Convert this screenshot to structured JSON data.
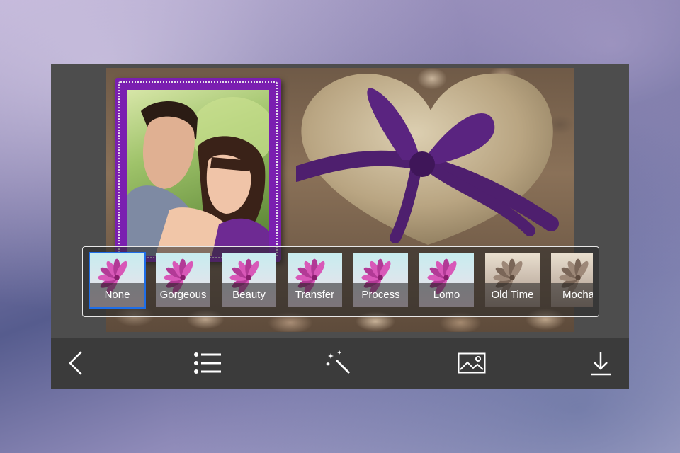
{
  "filters": [
    {
      "label": "None",
      "tone": "pink",
      "selected": true
    },
    {
      "label": "Gorgeous",
      "tone": "pink"
    },
    {
      "label": "Beauty",
      "tone": "pink"
    },
    {
      "label": "Transfer",
      "tone": "pink"
    },
    {
      "label": "Process",
      "tone": "pink"
    },
    {
      "label": "Lomo",
      "tone": "pink"
    },
    {
      "label": "Old Time",
      "tone": "sepia"
    },
    {
      "label": "Mocha",
      "tone": "sepia"
    }
  ],
  "toolbar": {
    "icons": [
      "back-arrow-icon",
      "list-icon",
      "magic-wand-icon",
      "image-icon",
      "download-icon"
    ]
  },
  "colors": {
    "frame": "#7a1fb0",
    "selected_border": "#1e6ee8",
    "toolbar_bg": "#3b3b3b",
    "device_bg": "#4d4d4d"
  }
}
